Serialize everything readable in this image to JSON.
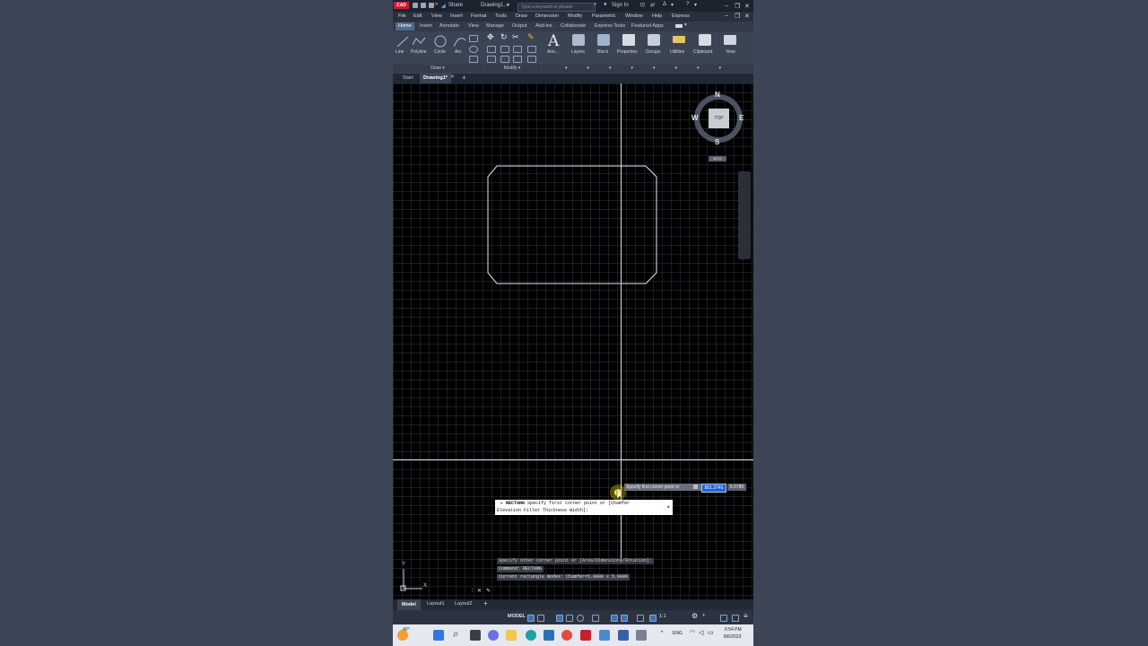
{
  "title_bar": {
    "logo": "CAD",
    "share_label": "Share",
    "doc_title": "Drawing1...",
    "search_placeholder": "Type a keyword or phrase",
    "sign_in_label": "Sign In"
  },
  "menu": [
    "File",
    "Edit",
    "View",
    "Insert",
    "Format",
    "Tools",
    "Draw",
    "Dimension",
    "Modify",
    "Parametric",
    "Window",
    "Help",
    "Express"
  ],
  "ribbon_tabs": [
    "Home",
    "Insert",
    "Annotate",
    "View",
    "Manage",
    "Output",
    "Add-ins",
    "Collaborate",
    "Express Tools",
    "Featured Apps"
  ],
  "ribbon": {
    "draw_tools": [
      "Line",
      "Polyline",
      "Circle",
      "Arc"
    ],
    "big_tools": [
      "Ann...",
      "Layers",
      "Block",
      "Properties",
      "Groups",
      "Utilities",
      "Clipboard",
      "View"
    ],
    "panels": {
      "draw": "Draw ▾",
      "modify": "Modify ▾"
    }
  },
  "doc_tabs": {
    "start": "Start",
    "active": "Drawing1*",
    "add": "+"
  },
  "viewcube": {
    "n": "N",
    "s": "S",
    "e": "E",
    "w": "W",
    "face": "TOP",
    "wcs": "WCS"
  },
  "ucs": {
    "x": "X",
    "y": "Y"
  },
  "tooltip": {
    "prompt": "Specify first corner point or",
    "x_value": "851.3745",
    "y_value": "5.5789"
  },
  "command_history": [
    "Specify other corner point or [Area/Dimensions/Rotation]:",
    "Command:  RECTANG",
    "Current rectangle modes:  Chamfer=5.0000 x 5.0000"
  ],
  "command_line": {
    "prefix": "▸ RECTANG",
    "line1": "Specify first corner point or [Chamfer",
    "line2": "Elevation Fillet Thickness Width]:"
  },
  "layout_tabs": {
    "model": "Model",
    "layout1": "Layout1",
    "layout2": "Layout2",
    "add": "+"
  },
  "status": {
    "model": "MODEL",
    "scale": "1:1"
  },
  "taskbar": {
    "weather": "40°",
    "lang": "ENG",
    "time": "6:54 PM",
    "date": "8/6/2023"
  },
  "colors": {
    "accent": "#4f6a8f",
    "autodesk_red": "#c8202e",
    "cursor_glow": "#f4e000",
    "highlight": "#1e64d8"
  }
}
